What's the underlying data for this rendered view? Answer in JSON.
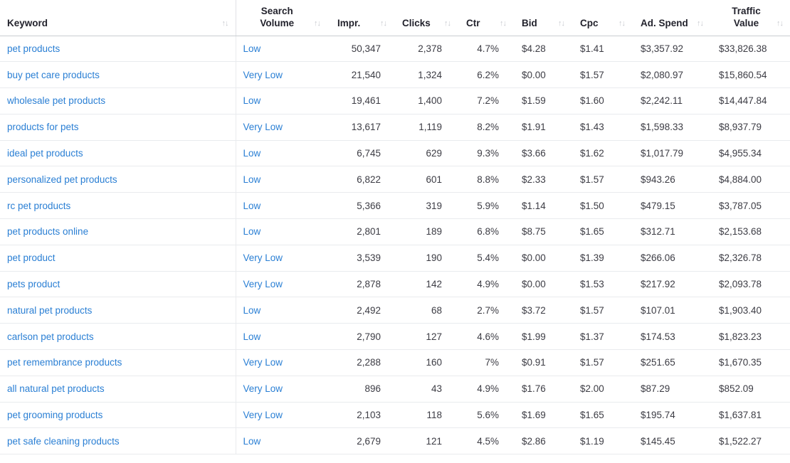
{
  "table": {
    "name": "keyword-performance-table",
    "sort_icon_glyph": "↑↓",
    "columns": [
      {
        "key": "keyword",
        "label": "Keyword",
        "sortable": true,
        "align": "left"
      },
      {
        "key": "search_volume",
        "label": "Search Volume",
        "sortable": true,
        "align": "left"
      },
      {
        "key": "impr",
        "label": "Impr.",
        "sortable": true,
        "align": "right"
      },
      {
        "key": "clicks",
        "label": "Clicks",
        "sortable": true,
        "align": "right"
      },
      {
        "key": "ctr",
        "label": "Ctr",
        "sortable": true,
        "align": "right"
      },
      {
        "key": "bid",
        "label": "Bid",
        "sortable": true,
        "align": "left"
      },
      {
        "key": "cpc",
        "label": "Cpc",
        "sortable": true,
        "align": "left"
      },
      {
        "key": "ad_spend",
        "label": "Ad. Spend",
        "sortable": true,
        "align": "left"
      },
      {
        "key": "traffic_value",
        "label": "Traffic Value",
        "sortable": true,
        "align": "left"
      }
    ],
    "link_color": "#2a7fd4",
    "rows": [
      {
        "keyword": "pet products",
        "search_volume": "Low",
        "impr": "50,347",
        "clicks": "2,378",
        "ctr": "4.7%",
        "bid": "$4.28",
        "cpc": "$1.41",
        "ad_spend": "$3,357.92",
        "traffic_value": "$33,826.38"
      },
      {
        "keyword": "buy pet care products",
        "search_volume": "Very Low",
        "impr": "21,540",
        "clicks": "1,324",
        "ctr": "6.2%",
        "bid": "$0.00",
        "cpc": "$1.57",
        "ad_spend": "$2,080.97",
        "traffic_value": "$15,860.54"
      },
      {
        "keyword": "wholesale pet products",
        "search_volume": "Low",
        "impr": "19,461",
        "clicks": "1,400",
        "ctr": "7.2%",
        "bid": "$1.59",
        "cpc": "$1.60",
        "ad_spend": "$2,242.11",
        "traffic_value": "$14,447.84"
      },
      {
        "keyword": "products for pets",
        "search_volume": "Very Low",
        "impr": "13,617",
        "clicks": "1,119",
        "ctr": "8.2%",
        "bid": "$1.91",
        "cpc": "$1.43",
        "ad_spend": "$1,598.33",
        "traffic_value": "$8,937.79"
      },
      {
        "keyword": "ideal pet products",
        "search_volume": "Low",
        "impr": "6,745",
        "clicks": "629",
        "ctr": "9.3%",
        "bid": "$3.66",
        "cpc": "$1.62",
        "ad_spend": "$1,017.79",
        "traffic_value": "$4,955.34"
      },
      {
        "keyword": "personalized pet products",
        "search_volume": "Low",
        "impr": "6,822",
        "clicks": "601",
        "ctr": "8.8%",
        "bid": "$2.33",
        "cpc": "$1.57",
        "ad_spend": "$943.26",
        "traffic_value": "$4,884.00"
      },
      {
        "keyword": "rc pet products",
        "search_volume": "Low",
        "impr": "5,366",
        "clicks": "319",
        "ctr": "5.9%",
        "bid": "$1.14",
        "cpc": "$1.50",
        "ad_spend": "$479.15",
        "traffic_value": "$3,787.05"
      },
      {
        "keyword": "pet products online",
        "search_volume": "Low",
        "impr": "2,801",
        "clicks": "189",
        "ctr": "6.8%",
        "bid": "$8.75",
        "cpc": "$1.65",
        "ad_spend": "$312.71",
        "traffic_value": "$2,153.68"
      },
      {
        "keyword": "pet product",
        "search_volume": "Very Low",
        "impr": "3,539",
        "clicks": "190",
        "ctr": "5.4%",
        "bid": "$0.00",
        "cpc": "$1.39",
        "ad_spend": "$266.06",
        "traffic_value": "$2,326.78"
      },
      {
        "keyword": "pets product",
        "search_volume": "Very Low",
        "impr": "2,878",
        "clicks": "142",
        "ctr": "4.9%",
        "bid": "$0.00",
        "cpc": "$1.53",
        "ad_spend": "$217.92",
        "traffic_value": "$2,093.78"
      },
      {
        "keyword": "natural pet products",
        "search_volume": "Low",
        "impr": "2,492",
        "clicks": "68",
        "ctr": "2.7%",
        "bid": "$3.72",
        "cpc": "$1.57",
        "ad_spend": "$107.01",
        "traffic_value": "$1,903.40"
      },
      {
        "keyword": "carlson pet products",
        "search_volume": "Low",
        "impr": "2,790",
        "clicks": "127",
        "ctr": "4.6%",
        "bid": "$1.99",
        "cpc": "$1.37",
        "ad_spend": "$174.53",
        "traffic_value": "$1,823.23"
      },
      {
        "keyword": "pet remembrance products",
        "search_volume": "Very Low",
        "impr": "2,288",
        "clicks": "160",
        "ctr": "7%",
        "bid": "$0.91",
        "cpc": "$1.57",
        "ad_spend": "$251.65",
        "traffic_value": "$1,670.35"
      },
      {
        "keyword": "all natural pet products",
        "search_volume": "Very Low",
        "impr": "896",
        "clicks": "43",
        "ctr": "4.9%",
        "bid": "$1.76",
        "cpc": "$2.00",
        "ad_spend": "$87.29",
        "traffic_value": "$852.09"
      },
      {
        "keyword": "pet grooming products",
        "search_volume": "Very Low",
        "impr": "2,103",
        "clicks": "118",
        "ctr": "5.6%",
        "bid": "$1.69",
        "cpc": "$1.65",
        "ad_spend": "$195.74",
        "traffic_value": "$1,637.81"
      },
      {
        "keyword": "pet safe cleaning products",
        "search_volume": "Low",
        "impr": "2,679",
        "clicks": "121",
        "ctr": "4.5%",
        "bid": "$2.86",
        "cpc": "$1.19",
        "ad_spend": "$145.45",
        "traffic_value": "$1,522.27"
      }
    ]
  }
}
